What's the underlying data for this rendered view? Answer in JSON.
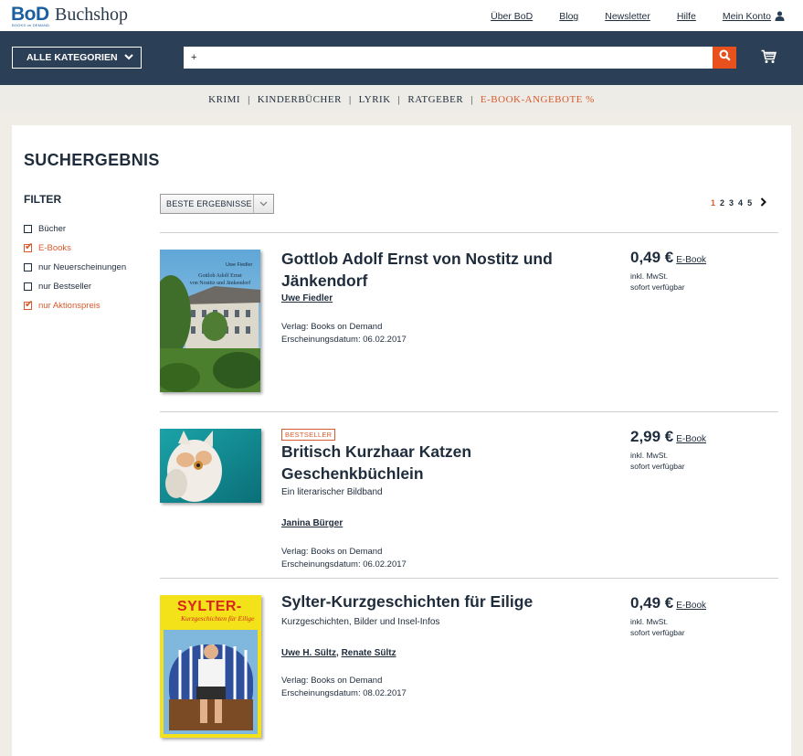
{
  "brand": {
    "logo_mark": "BoD",
    "logo_tagline": "BOOKS on DEMAND",
    "logo_text": "Buchshop"
  },
  "top_links": [
    "Über BoD",
    "Blog",
    "Newsletter",
    "Hilfe",
    "Mein Konto"
  ],
  "nav": {
    "categories_button": "ALLE KATEGORIEN",
    "search_value": "+",
    "search_placeholder": ""
  },
  "category_strip": [
    "KRIMI",
    "KINDERBÜCHER",
    "LYRIK",
    "RATGEBER",
    "E-BOOK-ANGEBOTE %"
  ],
  "page": {
    "title": "SUCHERGEBNIS",
    "filter_title": "FILTER",
    "filters": [
      {
        "label": "Bücher",
        "checked": false
      },
      {
        "label": "E-Books",
        "checked": true
      },
      {
        "label": "nur Neuerscheinungen",
        "checked": false
      },
      {
        "label": "nur Bestseller",
        "checked": false
      },
      {
        "label": "nur Aktionspreis",
        "checked": true
      }
    ],
    "sort_label": "BESTE ERGEBNISSE",
    "pages": [
      "1",
      "2",
      "3",
      "4",
      "5"
    ],
    "current_page": "1"
  },
  "results": [
    {
      "title": "Gottlob Adolf Ernst von Nostitz und Jänkendorf",
      "subtitle": "",
      "badge": "",
      "authors": [
        "Uwe Fiedler"
      ],
      "publisher": "Verlag: Books on Demand",
      "date": "Erscheinungsdatum: 06.02.2017",
      "price": "0,49 €",
      "format": "E-Book",
      "vat": "inkl. MwSt.",
      "availability": "sofort verfügbar",
      "cover": {
        "author": "Uwe Fiedler",
        "title_line1": "Gottlob Adolf Ernst",
        "title_line2": "von Nostitz und Jänkendorf"
      }
    },
    {
      "title": "Britisch Kurzhaar Katzen Geschenkbüchlein",
      "subtitle": "Ein literarischer Bildband",
      "badge": "BESTSELLER",
      "authors": [
        "Janina Bürger"
      ],
      "publisher": "Verlag: Books on Demand",
      "date": "Erscheinungsdatum: 06.02.2017",
      "price": "2,99 €",
      "format": "E-Book",
      "vat": "inkl. MwSt.",
      "availability": "sofort verfügbar"
    },
    {
      "title": "Sylter-Kurzgeschichten für Eilige",
      "subtitle": "Kurzgeschichten, Bilder und Insel-Infos",
      "badge": "",
      "authors": [
        "Uwe H. Sültz",
        "Renate Sültz"
      ],
      "publisher": "Verlag: Books on Demand",
      "date": "Erscheinungsdatum: 08.02.2017",
      "price": "0,49 €",
      "format": "E-Book",
      "vat": "inkl. MwSt.",
      "availability": "sofort verfügbar",
      "cover": {
        "title": "SYLTER-",
        "subtitle": "Kurzgeschichten für Eilige"
      }
    }
  ],
  "colors": {
    "navy": "#2b3f56",
    "accent": "#d75a2d",
    "search_button": "#e8501e",
    "brand_blue": "#1c5fa0"
  }
}
